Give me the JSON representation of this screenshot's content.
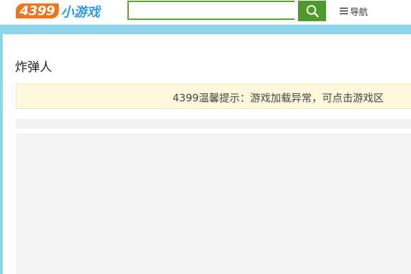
{
  "header": {
    "logo_number": "4399",
    "logo_text": "小游戏",
    "search": {
      "placeholder": "",
      "value": "",
      "button_icon": "search-icon"
    },
    "nav_label": "导航",
    "nav_icon": "menu-icon"
  },
  "colors": {
    "page_background": "#8dd3ea",
    "logo_orange": "#f0731d",
    "logo_blue": "#2a9de6",
    "search_green": "#4e9a2c",
    "notice_background": "#fdf7dc"
  },
  "main": {
    "game_title": "炸弹人",
    "notice_text": "4399温馨提示：游戏加载异常，可点击游戏区"
  }
}
